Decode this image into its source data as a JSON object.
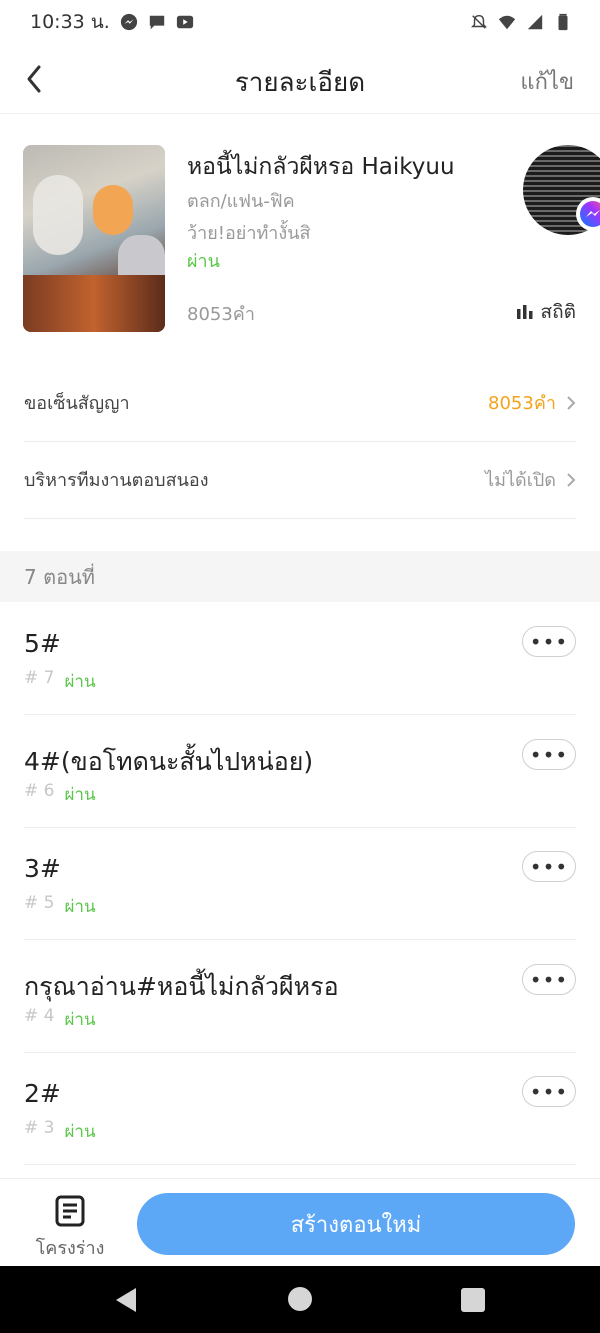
{
  "status_bar": {
    "time": "10:33 น."
  },
  "header": {
    "title": "รายละเอียด",
    "edit_label": "แก้ไข"
  },
  "book": {
    "title": "หอนี้ไม่กลัวผีหรอ Haikyuu",
    "genre": "ตลก/แฟน-ฟิค",
    "subtitle": "ว้าย!อย่าทำงั้นสิ",
    "status": "ผ่าน",
    "word_count": "8053คำ",
    "stats_label": "สถิติ"
  },
  "settings": [
    {
      "label": "ขอเซ็นสัญญา",
      "value": "8053คำ",
      "value_color": "#f3a31c"
    },
    {
      "label": "บริหารทีมงานตอบสนอง",
      "value": "ไม่ได้เปิด",
      "value_color": "#999999"
    }
  ],
  "chapters_header": "7 ตอนที่",
  "chapters": [
    {
      "title": "5#",
      "number": "# 7",
      "status": "ผ่าน"
    },
    {
      "title": "4#(ขอโทดนะสั้นไปหน่อย)",
      "number": "# 6",
      "status": "ผ่าน"
    },
    {
      "title": "3#",
      "number": "# 5",
      "status": "ผ่าน"
    },
    {
      "title": "กรุณาอ่าน#หอนี้ไม่กลัวผีหรอ",
      "number": "# 4",
      "status": "ผ่าน"
    },
    {
      "title": "2#",
      "number": "# 3",
      "status": "ผ่าน"
    }
  ],
  "bottom_bar": {
    "outline_label": "โครงร่าง",
    "create_label": "สร้างตอนใหม่"
  },
  "more_label": "•••",
  "colors": {
    "accent": "#5ca8f6",
    "pass": "#5cc64a",
    "warning": "#f3a31c"
  }
}
